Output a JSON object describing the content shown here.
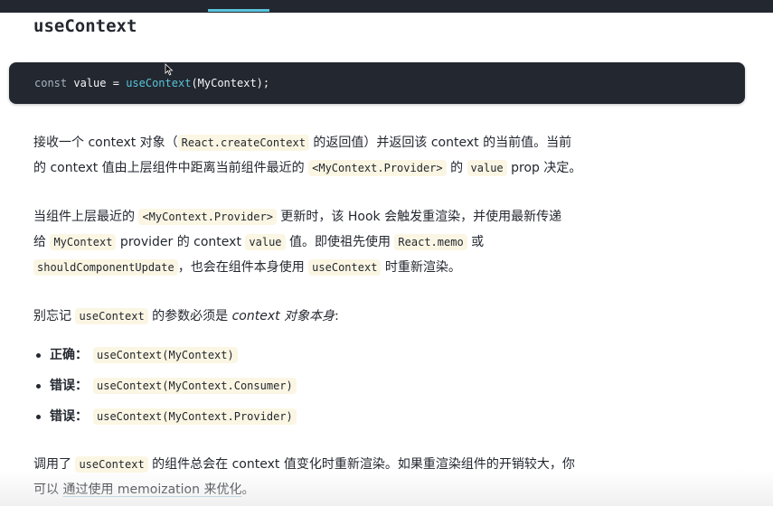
{
  "heading": "useContext",
  "code": {
    "kw": "const",
    "var": "value",
    "op": "=",
    "fn": "useContext",
    "arg": "(MyContext);"
  },
  "p1": {
    "t1": "接收一个 context 对象（",
    "c1": "React.createContext",
    "t2": " 的返回值）并返回该 context 的当前值。当前",
    "t3": "的 context 值由上层组件中距离当前组件最近的 ",
    "c2": "<MyContext.Provider>",
    "t4": " 的 ",
    "c3": "value",
    "t5": " prop 决定。"
  },
  "p2": {
    "t1": "当组件上层最近的 ",
    "c1": "<MyContext.Provider>",
    "t2": " 更新时，该 Hook 会触发重渲染，并使用最新传递",
    "t3": "给 ",
    "c2": "MyContext",
    "t4": " provider 的 context ",
    "c3": "value",
    "t5": " 值。即使祖先使用 ",
    "c4": "React.memo",
    "t6": " 或",
    "c5": "shouldComponentUpdate",
    "t7": "，也会在组件本身使用 ",
    "c6": "useContext",
    "t8": " 时重新渲染。"
  },
  "p3": {
    "t1": "别忘记 ",
    "c1": "useContext",
    "t2": " 的参数必须是 ",
    "em": "context 对象本身",
    "t3": ":"
  },
  "list": [
    {
      "label": "正确：",
      "code": "useContext(MyContext)"
    },
    {
      "label": "错误：",
      "code": "useContext(MyContext.Consumer)"
    },
    {
      "label": "错误：",
      "code": "useContext(MyContext.Provider)"
    }
  ],
  "p4": {
    "t1": "调用了 ",
    "c1": "useContext",
    "t2": " 的组件总会在 context 值变化时重新渲染。如果重渲染组件的开销较大，你",
    "t3": "可以 ",
    "link": "通过使用 memoization 来优化",
    "t4": "。"
  }
}
